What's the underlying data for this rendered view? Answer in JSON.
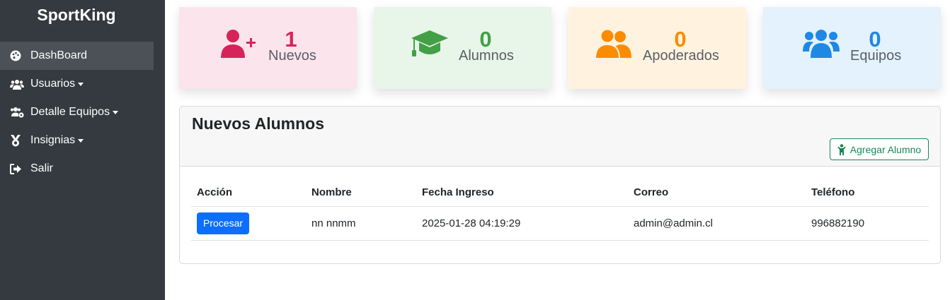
{
  "sidebar": {
    "brand": "SportKing",
    "items": [
      {
        "label": "DashBoard",
        "icon": "palette-icon",
        "active": true,
        "dropdown": false
      },
      {
        "label": "Usuarios",
        "icon": "users-icon",
        "active": false,
        "dropdown": true
      },
      {
        "label": "Detalle Equipos",
        "icon": "users-gear-icon",
        "active": false,
        "dropdown": true
      },
      {
        "label": "Insignias",
        "icon": "medal-icon",
        "active": false,
        "dropdown": true
      },
      {
        "label": "Salir",
        "icon": "sign-out-icon",
        "active": false,
        "dropdown": false
      }
    ]
  },
  "stats": [
    {
      "value": "1",
      "label": "Nuevos",
      "icon": "user-plus-icon",
      "color": "#d6245a",
      "bg": "#fce4ec"
    },
    {
      "value": "0",
      "label": "Alumnos",
      "icon": "graduation-cap-icon",
      "color": "#43a047",
      "bg": "#e8f5e9"
    },
    {
      "value": "0",
      "label": "Apoderados",
      "icon": "user-friends-icon",
      "color": "#fb8c00",
      "bg": "#fff3e0"
    },
    {
      "value": "0",
      "label": "Equipos",
      "icon": "users-icon",
      "color": "#1e88e5",
      "bg": "#e3f2fd"
    }
  ],
  "panel": {
    "title": "Nuevos Alumnos",
    "add_button": "Agregar Alumno",
    "columns": [
      "Acción",
      "Nombre",
      "Fecha Ingreso",
      "Correo",
      "Teléfono"
    ],
    "rows": [
      {
        "action": "Procesar",
        "nombre": "nn nnmm",
        "fecha": "2025-01-28 04:19:29",
        "correo": "admin@admin.cl",
        "telefono": "996882190"
      }
    ]
  }
}
